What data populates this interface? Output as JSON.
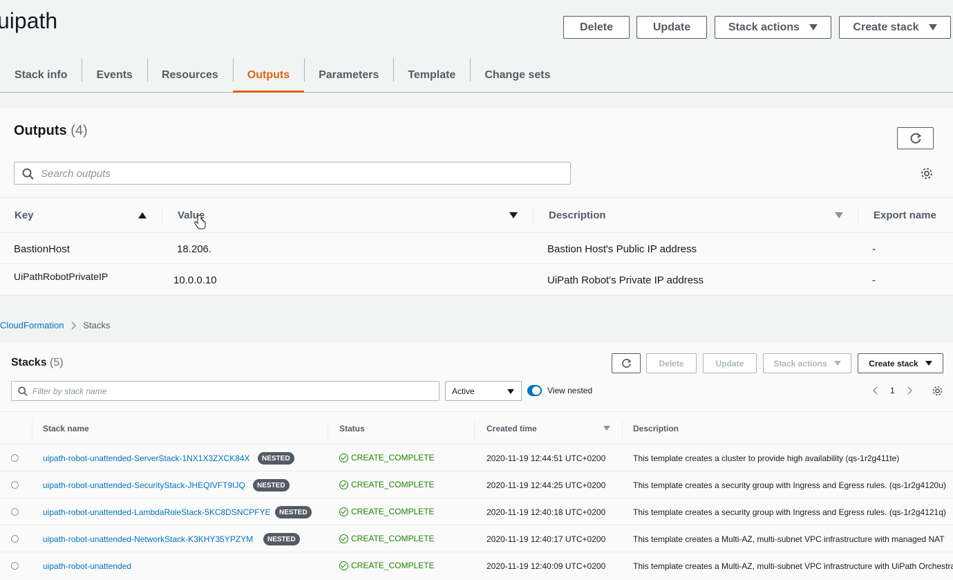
{
  "stack": {
    "title": "uipath",
    "buttons": {
      "delete": "Delete",
      "update": "Update",
      "stack_actions": "Stack actions",
      "create_stack": "Create stack"
    },
    "tabs": [
      "Stack info",
      "Events",
      "Resources",
      "Outputs",
      "Parameters",
      "Template",
      "Change sets"
    ],
    "active_tab": "Outputs"
  },
  "outputs": {
    "heading": "Outputs",
    "count": "(4)",
    "search_placeholder": "Search outputs",
    "columns": {
      "key": "Key",
      "value": "Value",
      "description": "Description",
      "export": "Export name"
    },
    "rows": [
      {
        "key": "BastionHost",
        "value": "18.206.",
        "description": "Bastion Host's Public IP address",
        "export": "-"
      },
      {
        "key": "UiPathRobotPrivateIP",
        "value": "10.0.0.10",
        "description": "UiPath  Robot's Private IP address",
        "export": "-"
      }
    ]
  },
  "breadcrumb": {
    "root": "CloudFormation",
    "current": "Stacks"
  },
  "stacks": {
    "heading": "Stacks",
    "count": "(5)",
    "buttons": {
      "delete": "Delete",
      "update": "Update",
      "stack_actions": "Stack actions",
      "create_stack": "Create stack"
    },
    "filter_placeholder": "Filter by stack name",
    "select_value": "Active",
    "view_nested_label": "View nested",
    "page": "1",
    "columns": {
      "name": "Stack name",
      "status": "Status",
      "created": "Created time",
      "description": "Description"
    },
    "rows": [
      {
        "name": "uipath-robot-unattended-ServerStack-1NX1X3ZXCK84X",
        "badge": "NESTED",
        "status": "CREATE_COMPLETE",
        "created": "2020-11-19 12:44:51 UTC+0200",
        "description": "This template creates a cluster to provide high availability (qs-1r2g411te)"
      },
      {
        "name": "uipath-robot-unattended-SecurityStack-JHEQIVFT9IJQ",
        "badge": "NESTED",
        "status": "CREATE_COMPLETE",
        "created": "2020-11-19 12:44:25 UTC+0200",
        "description": "This template creates a security group with Ingress and Egress rules. (qs-1r2g4120u)"
      },
      {
        "name": "uipath-robot-unattended-LambdaRoleStack-5KC8DSNCPFYE",
        "badge": "NESTED",
        "status": "CREATE_COMPLETE",
        "created": "2020-11-19 12:40:18 UTC+0200",
        "description": "This template creates a security group with Ingress and Egress rules. (qs-1r2g4121q)"
      },
      {
        "name": "uipath-robot-unattended-NetworkStack-K3KHY35YPZYM",
        "badge": "NESTED",
        "status": "CREATE_COMPLETE",
        "created": "2020-11-19 12:40:17 UTC+0200",
        "description": "This template creates a Multi-AZ, multi-subnet VPC infrastructure with managed NAT"
      },
      {
        "name": "uipath-robot-unattended",
        "badge": "",
        "status": "CREATE_COMPLETE",
        "created": "2020-11-19 12:40:09 UTC+0200",
        "description": "This template creates a Multi-AZ, multi-subnet VPC infrastructure with UiPath Orchestrator"
      }
    ]
  },
  "colors": {
    "accent": "#d86613",
    "link": "#0073bb",
    "success": "#1d8102"
  }
}
